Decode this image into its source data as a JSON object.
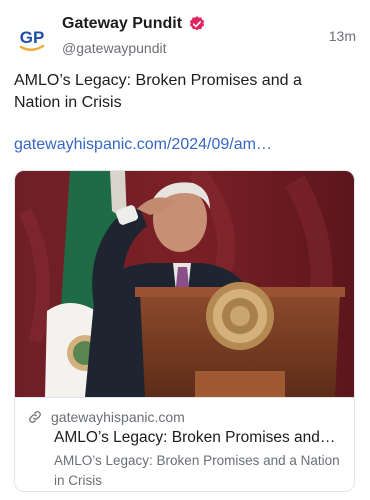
{
  "author": {
    "display_name": "Gateway Pundit",
    "handle": "@gatewaypundit",
    "avatar_text": "GP",
    "verified_color": "#e0245e"
  },
  "post": {
    "time_ago": "13m",
    "text": "AMLO’s Legacy: Broken Promises and a Nation in Crisis",
    "link_text": "gatewayhispanic.com/2024/09/am…"
  },
  "card": {
    "domain": "gatewayhispanic.com",
    "title": "AMLO’s Legacy: Broken Promises and…",
    "description": "AMLO’s Legacy: Broken Promises and a Nation in Crisis",
    "image_description_icon": "photo"
  },
  "colors": {
    "link": "#3567c4",
    "brand_blue": "#1d4fa3",
    "brand_orange": "#f2a93b"
  }
}
